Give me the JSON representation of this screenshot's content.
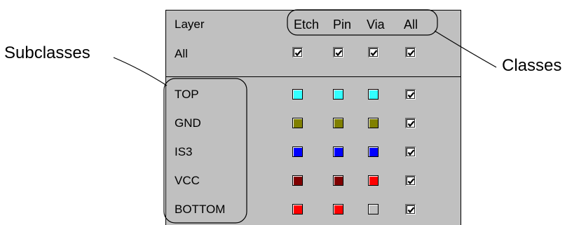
{
  "annotations": {
    "subclasses_label": "Subclasses",
    "classes_label": "Classes"
  },
  "header": {
    "layer_label": "Layer",
    "columns": [
      "Etch",
      "Pin",
      "Via",
      "All"
    ]
  },
  "all_row": {
    "label": "All",
    "checks": [
      true,
      true,
      true,
      true
    ]
  },
  "rows": [
    {
      "label": "TOP",
      "etch_color": "#33ffff",
      "pin_color": "#33ffff",
      "via_color": "#33ffff",
      "all_checked": true
    },
    {
      "label": "GND",
      "etch_color": "#808000",
      "pin_color": "#808000",
      "via_color": "#808000",
      "all_checked": true
    },
    {
      "label": "IS3",
      "etch_color": "#0000ff",
      "pin_color": "#0000ff",
      "via_color": "#0000ff",
      "all_checked": true
    },
    {
      "label": "VCC",
      "etch_color": "#800000",
      "pin_color": "#800000",
      "via_color": "#ff0000",
      "all_checked": true
    },
    {
      "label": "BOTTOM",
      "etch_color": "#ff0000",
      "pin_color": "#ff0000",
      "via_color": "#c0c0c0",
      "all_checked": true
    }
  ],
  "colors": {
    "panel_bg": "#c0c0c0",
    "page_bg": "#ffffff"
  }
}
